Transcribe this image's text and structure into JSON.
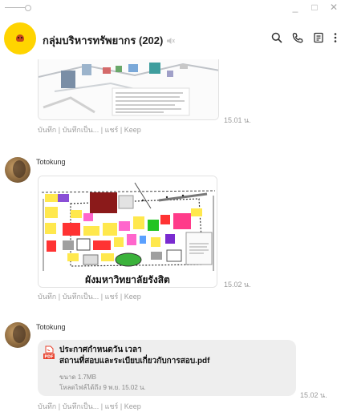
{
  "window": {
    "minimize": "_",
    "maximize": "□",
    "close": "✕"
  },
  "header": {
    "title": "กลุ่มบริหารทรัพยากร (202)"
  },
  "messages": [
    {
      "time": "15.01 น.",
      "actions": "บันทึก | บันทึกเป็น... | แชร์ | Keep"
    },
    {
      "sender": "Totokung",
      "caption": "ผังมหาวิทยาลัยรังสิต",
      "time": "15.02 น.",
      "actions": "บันทึก | บันทึกเป็น... | แชร์ | Keep"
    },
    {
      "sender": "Totokung",
      "file_line1": "ประกาศกำหนดวัน เวลา",
      "file_line2": "สถานที่สอบและระเบียบเกี่ยวกับการสอบ.pdf",
      "size": "ขนาด 1.7MB",
      "expire": "โหลดไฟล์ได้ถึง 9 พ.ย. 15.02 น.",
      "time": "15.02 น.",
      "actions": "บันทึก | บันทึกเป็น... | แชร์ | Keep"
    }
  ],
  "colors": {
    "group_avatar": "#ffd400",
    "bubble": "#eeeeee",
    "pdf": "#e8412c"
  }
}
